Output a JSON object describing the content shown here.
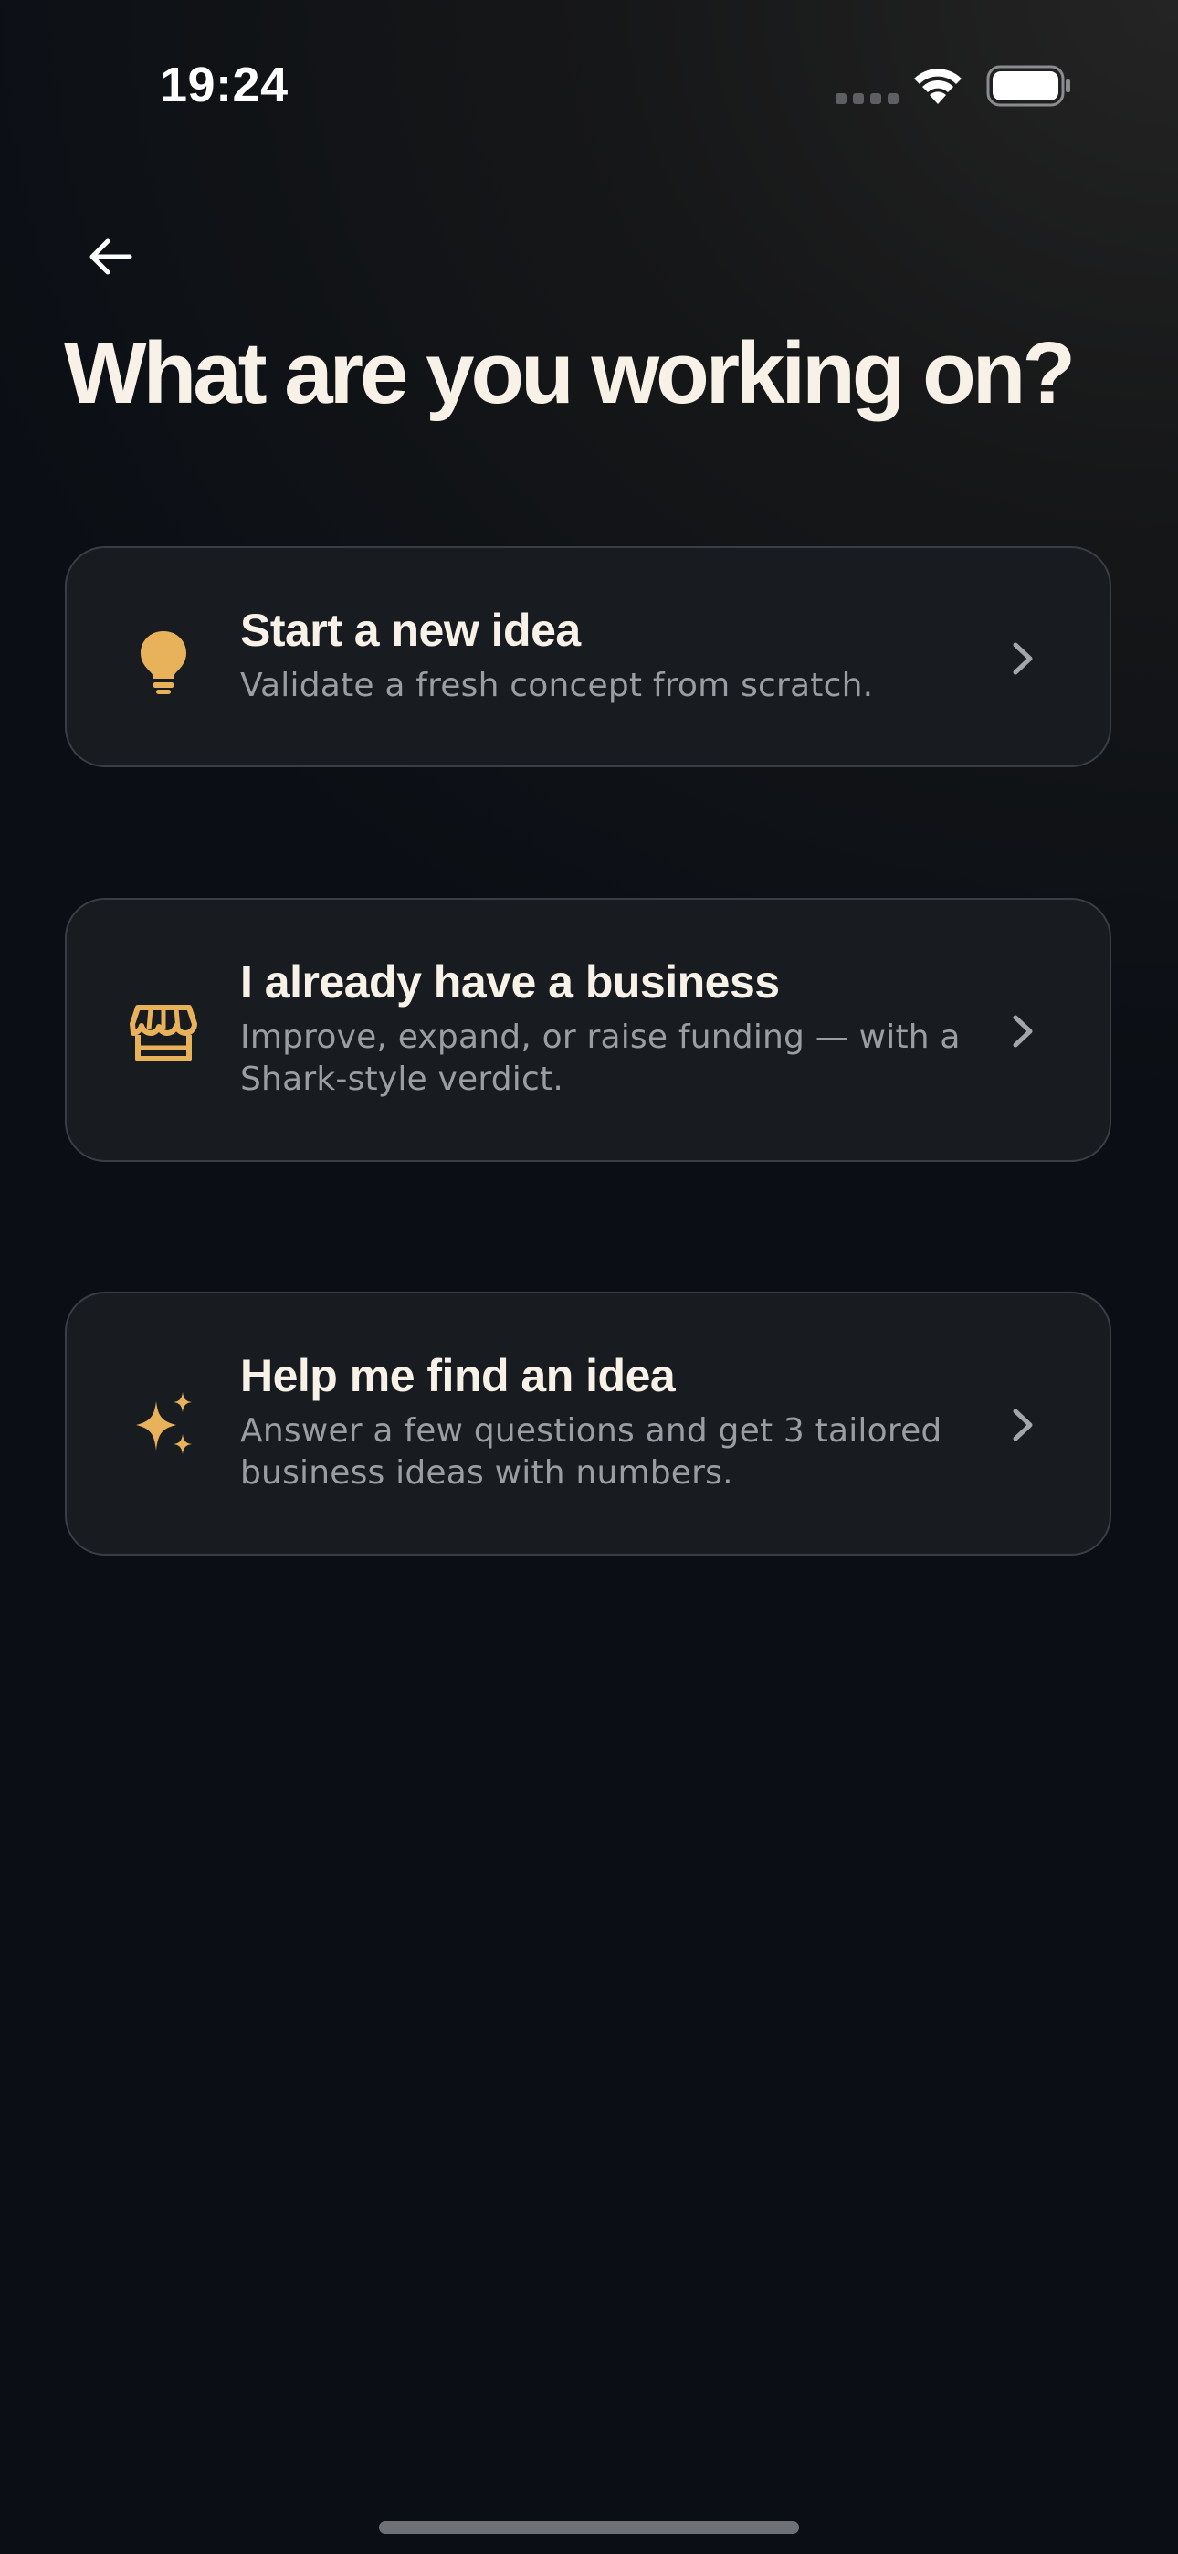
{
  "status_bar": {
    "time": "19:24"
  },
  "header": {
    "title": "What are you working on?"
  },
  "options": [
    {
      "icon": "lightbulb-icon",
      "title": "Start a new idea",
      "description": "Validate a fresh concept from scratch."
    },
    {
      "icon": "storefront-icon",
      "title": "I already have a business",
      "description": "Improve, expand, or raise funding — with a Shark-style verdict."
    },
    {
      "icon": "sparkles-icon",
      "title": "Help me find an idea",
      "description": "Answer a few questions and get 3 tailored business ideas with numbers."
    }
  ],
  "colors": {
    "accent": "#e8b25a",
    "background": "#0b0f15",
    "card_background": "#181c21",
    "card_border": "#3a3e44",
    "title_text": "#f7f1e7",
    "secondary_text": "#9a9ea3"
  }
}
